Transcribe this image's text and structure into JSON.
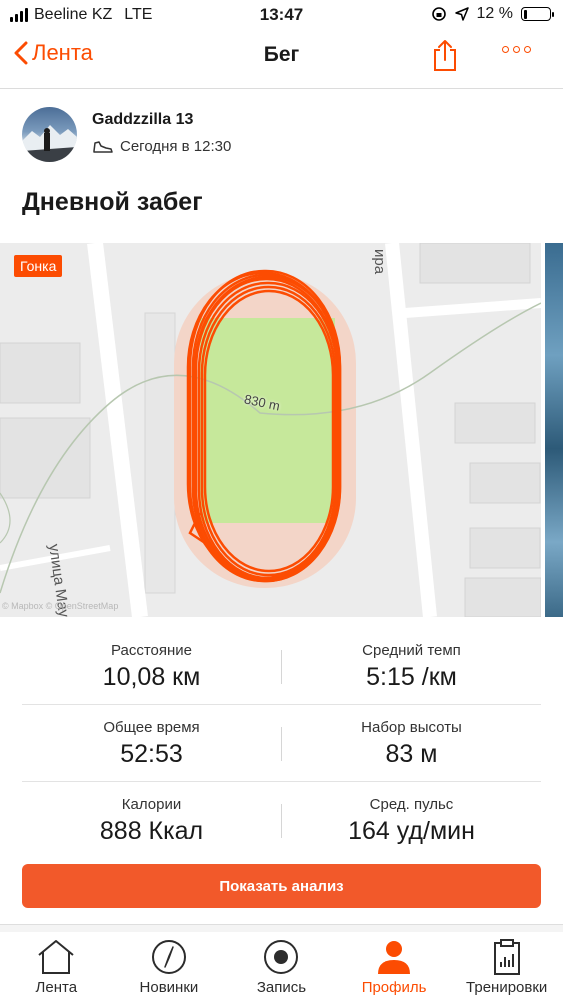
{
  "status_bar": {
    "carrier": "Beeline KZ",
    "network": "LTE",
    "time": "13:47",
    "battery": "12 %",
    "battery_level": 0.12
  },
  "navbar": {
    "back_label": "Лента",
    "title": "Бег"
  },
  "athlete": {
    "name": "Gaddzzilla 13",
    "timestamp": "Сегодня в 12:30"
  },
  "activity": {
    "title": "Дневной забег"
  },
  "map": {
    "race_badge": "Гонка",
    "segment_label": "830 m",
    "street_label": "улица Мауленова",
    "street_label_partial": "ира",
    "attribution": "© Mapbox © OpenStreetMap"
  },
  "stats": [
    {
      "label": "Расстояние",
      "value": "10,08 км"
    },
    {
      "label": "Средний темп",
      "value": "5:15 /км"
    },
    {
      "label": "Общее время",
      "value": "52:53"
    },
    {
      "label": "Набор высоты",
      "value": "83 м"
    },
    {
      "label": "Калории",
      "value": "888 Ккал"
    },
    {
      "label": "Сред. пульс",
      "value": "164 уд/мин"
    }
  ],
  "cta_label": "Показать анализ",
  "tabbar": [
    {
      "label": "Лента",
      "icon": "house-icon",
      "active": false
    },
    {
      "label": "Новинки",
      "icon": "compass-icon",
      "active": false
    },
    {
      "label": "Запись",
      "icon": "record-icon",
      "active": false
    },
    {
      "label": "Профиль",
      "icon": "profile-icon",
      "active": true
    },
    {
      "label": "Тренировки",
      "icon": "clipboard-icon",
      "active": false
    }
  ],
  "colors": {
    "accent": "#fc4c02",
    "button": "#f2592a",
    "field": "#c6e89b",
    "track": "#f6d2c2"
  }
}
